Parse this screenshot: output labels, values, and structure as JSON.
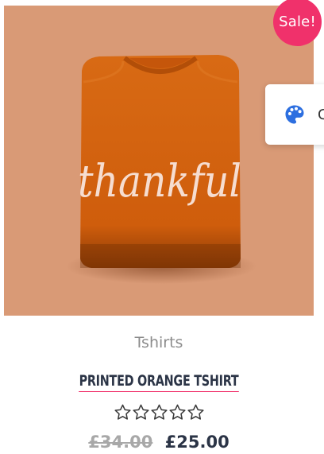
{
  "product": {
    "sale_badge": "Sale!",
    "category": "Tshirts",
    "title": "PRINTED ORANGE TSHIRT",
    "shirt_text": "thankful",
    "rating_stars": 5,
    "rating_value": 0,
    "price_old": "£34.00",
    "price_new": "£25.00"
  },
  "widget": {
    "icon": "palette-icon",
    "label": "C"
  },
  "colors": {
    "image_background": "#d99a76",
    "shirt": "#d4620f",
    "badge": "#f0316b",
    "title": "#2b3446",
    "category": "#8c8c8c",
    "old_price": "#a8a8a8",
    "palette_icon": "#2d6fe0"
  }
}
